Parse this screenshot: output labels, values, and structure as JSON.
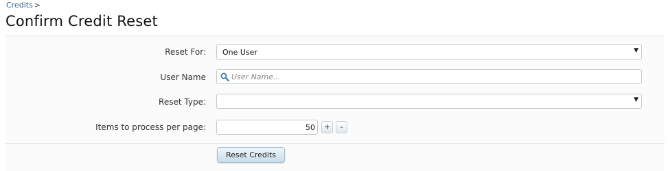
{
  "breadcrumb": {
    "items": [
      "Credits"
    ],
    "separator": ">"
  },
  "page": {
    "title": "Confirm Credit Reset"
  },
  "form": {
    "reset_for": {
      "label": "Reset For:",
      "selected": "One User"
    },
    "user_name": {
      "label": "User Name",
      "placeholder": "User Name...",
      "value": ""
    },
    "reset_type": {
      "label": "Reset Type:",
      "selected": ""
    },
    "items_per_page": {
      "label": "Items to process per page:",
      "value": "50",
      "increment": "+",
      "decrement": "-"
    },
    "submit_label": "Reset Credits"
  },
  "icons": {
    "search": "search-icon",
    "dropdown": "chevron-down-icon"
  },
  "colors": {
    "link": "#2a6496",
    "divider": "#d7e3ea",
    "search_icon": "#3a78b8"
  }
}
